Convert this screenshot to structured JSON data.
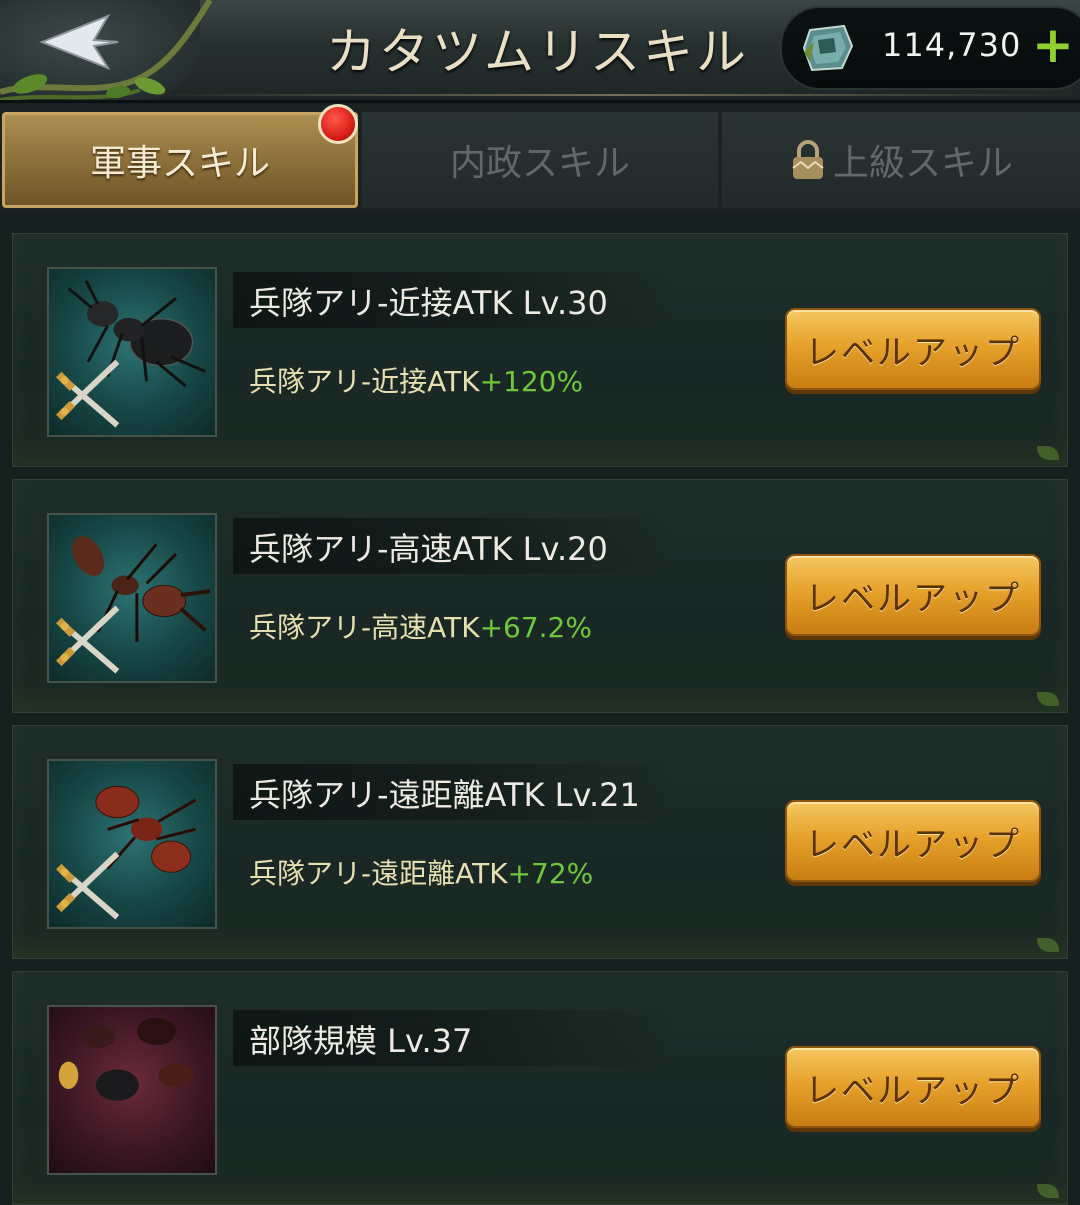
{
  "header": {
    "title": "カタツムリスキル",
    "currency_value": "114,730",
    "plus_symbol": "+"
  },
  "tabs": [
    {
      "label": "軍事スキル",
      "active": true,
      "has_notification": true
    },
    {
      "label": "内政スキル",
      "active": false
    },
    {
      "label": "上級スキル",
      "active": false,
      "locked": true
    }
  ],
  "skills": [
    {
      "name": "兵隊アリ-近接ATK Lv.30",
      "effect_text": "兵隊アリ-近接ATK",
      "bonus": "+120%",
      "button_label": "レベルアップ",
      "icon": "black-ant-melee-icon"
    },
    {
      "name": "兵隊アリ-高速ATK Lv.20",
      "effect_text": "兵隊アリ-高速ATK",
      "bonus": "+67.2%",
      "button_label": "レベルアップ",
      "icon": "brown-ant-speed-icon"
    },
    {
      "name": "兵隊アリ-遠距離ATK Lv.21",
      "effect_text": "兵隊アリ-遠距離ATK",
      "bonus": "+72%",
      "button_label": "レベルアップ",
      "icon": "red-ant-ranged-icon"
    },
    {
      "name": "部隊規模 Lv.37",
      "effect_text": "",
      "bonus": "",
      "button_label": "レベルアップ",
      "icon": "troop-size-icon"
    }
  ],
  "colors": {
    "active_tab": "#8a6d38",
    "bonus_green": "#6fc83b",
    "button_gold": "#e6a22c",
    "plus_green": "#8fd02e"
  }
}
